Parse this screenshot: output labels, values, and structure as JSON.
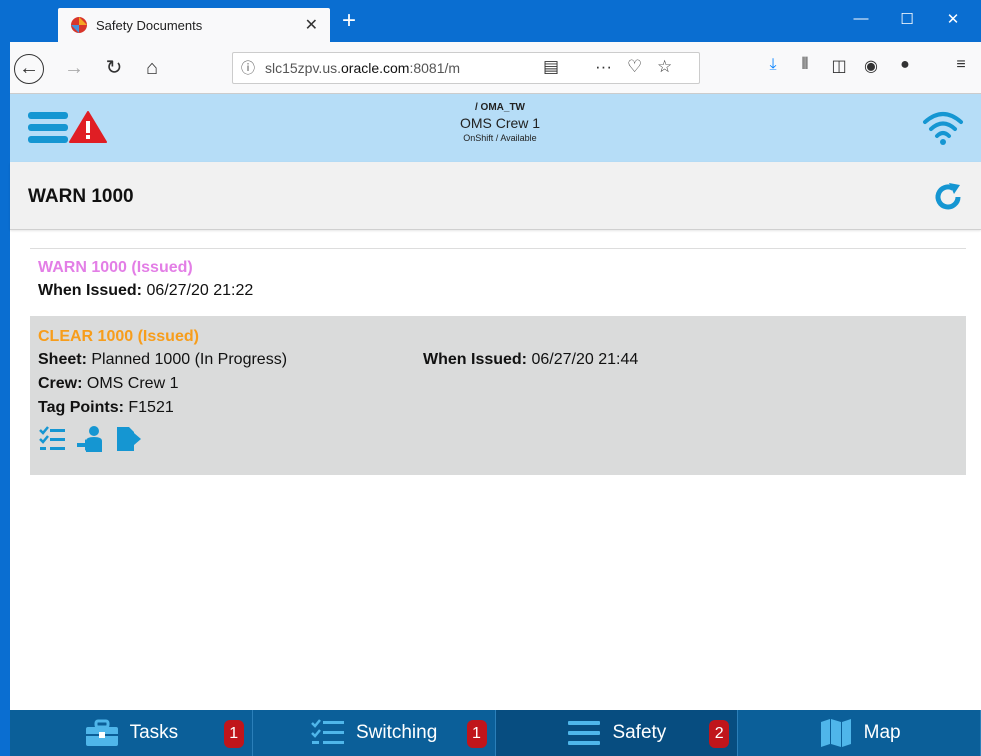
{
  "browser": {
    "tab_title": "Safety Documents",
    "url_prefix": "slc15zpv.us.",
    "url_host": "oracle.com",
    "url_suffix": ":8081/m"
  },
  "header": {
    "path": "/ OMA_TW",
    "crew": "OMS Crew 1",
    "status": "OnShift / Available"
  },
  "page": {
    "title": "WARN 1000"
  },
  "documents": [
    {
      "title": "WARN 1000 (Issued)",
      "when_label": "When Issued:",
      "when_value": "06/27/20 21:22"
    },
    {
      "title": "CLEAR 1000 (Issued)",
      "sheet_label": "Sheet:",
      "sheet_value": "Planned 1000 (In Progress)",
      "when_label": "When Issued:",
      "when_value": "06/27/20 21:44",
      "crew_label": "Crew:",
      "crew_value": "OMS Crew 1",
      "tag_label": "Tag Points:",
      "tag_value": "F1521"
    }
  ],
  "bottom_tabs": [
    {
      "label": "Tasks",
      "badge": "1",
      "icon": "toolbox-icon"
    },
    {
      "label": "Switching",
      "badge": "1",
      "icon": "checklist-icon"
    },
    {
      "label": "Safety",
      "badge": "2",
      "icon": "list-icon"
    },
    {
      "label": "Map",
      "badge": "",
      "icon": "map-icon"
    }
  ],
  "colors": {
    "accent": "#1596d2",
    "warn_title": "#e37ee6",
    "clear_title": "#f79d1b",
    "badge": "#c0151b",
    "bottom_bar": "#0b5f99"
  }
}
